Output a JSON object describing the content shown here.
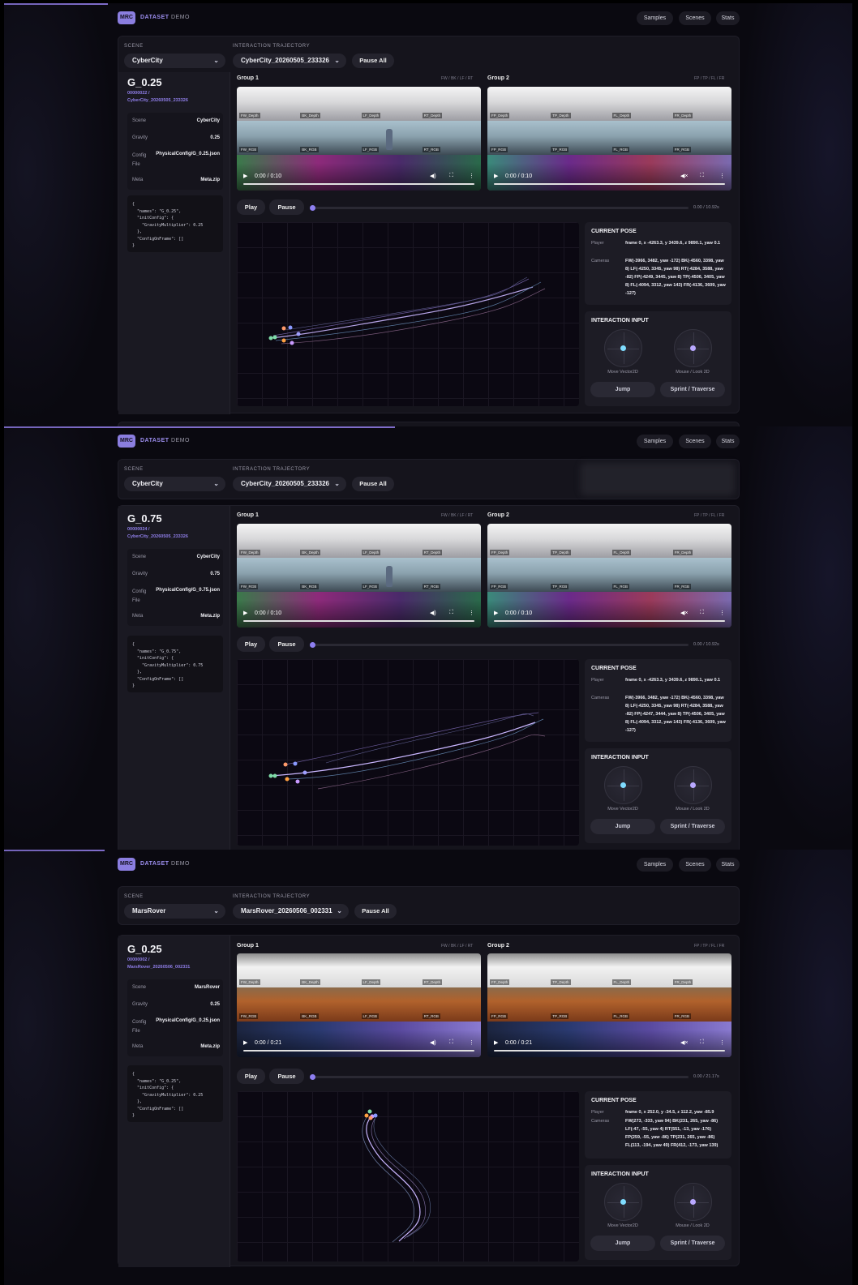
{
  "header": {
    "logo": "MRC",
    "brand_a": "DATASET",
    "brand_b": "DEMO",
    "nav": [
      "Samples",
      "Scenes",
      "Stats"
    ]
  },
  "labels": {
    "scene": "SCENE",
    "trajectory": "INTERACTION TRAJECTORY",
    "pause_all": "Pause All",
    "group1": "Group 1",
    "group2": "Group 2",
    "group1_views": "FW / BK / LF / RT",
    "group2_views": "FP / TP / FL / FR",
    "play": "Play",
    "pause": "Pause",
    "current_pose": "CURRENT POSE",
    "player": "Player",
    "cameras": "Cameras",
    "interaction_input": "INTERACTION INPUT",
    "move": "Move Vector2D",
    "look": "Mouse / Look 2D",
    "jump": "Jump",
    "sprint": "Sprint / Traverse",
    "k_scene": "Scene",
    "k_gravity": "Gravity",
    "k_config": "Config File",
    "k_meta": "Meta"
  },
  "tiles": {
    "g1_depth": [
      "FW_Depth",
      "BK_Depth",
      "LF_Depth",
      "RT_Depth"
    ],
    "g1_rgb": [
      "FW_RGB",
      "BK_RGB",
      "LF_RGB",
      "RT_RGB"
    ],
    "g2_depth": [
      "FP_Depth",
      "TP_Depth",
      "FL_Depth",
      "FR_Depth"
    ],
    "g2_rgb": [
      "FP_RGB",
      "TP_RGB",
      "FL_RGB",
      "FR_RGB"
    ]
  },
  "panels": [
    {
      "scene": "CyberCity",
      "trajectory": "CyberCity_20260505_233326",
      "title": "G_0.25",
      "sample_id": "00000022 /",
      "sample_name": "CyberCity_20260505_233326",
      "gravity": "0.25",
      "config": "PhysicalConfig/G_0.25.json",
      "meta": "Meta.zip",
      "json": "{\n  \"names\": \"G_0.25\",\n  \"initConfig\": {\n    \"GravityMultiplier\": 0.25\n  },\n  \"ConfigOnFrame\": []\n}",
      "video_time": "0:00 / 0:10",
      "slider_time": "0.00 / 10.92s",
      "player_pose": "frame 0, x -4263.3, y 3439.6, z 9890.1, yaw 0.1",
      "cameras_pose": "FW(-3966, 3482, yaw -172) BK(-4560, 3398, yaw 8) LF(-4250, 3345, yaw 98) RT(-4284, 3588, yaw -82) FP(-4249, 3445, yaw 8) TP(-4506, 3405, yaw 8) FL(-4094, 3312, yaw 143) FR(-4136, 3609, yaw -127)"
    },
    {
      "scene": "CyberCity",
      "trajectory": "CyberCity_20260505_233326",
      "title": "G_0.75",
      "sample_id": "00000024 /",
      "sample_name": "CyberCity_20260505_233326",
      "gravity": "0.75",
      "config": "PhysicalConfig/G_0.75.json",
      "meta": "Meta.zip",
      "json": "{\n  \"names\": \"G_0.75\",\n  \"initConfig\": {\n    \"GravityMultiplier\": 0.75\n  },\n  \"ConfigOnFrame\": []\n}",
      "video_time": "0:00 / 0:10",
      "slider_time": "0.00 / 10.92s",
      "player_pose": "frame 0, x -4263.3, y 3439.6, z 9890.1, yaw 0.1",
      "cameras_pose": "FW(-3966, 3482, yaw -172) BK(-4560, 3398, yaw 8) LF(-4250, 3345, yaw 98) RT(-4284, 3588, yaw -82) FP(-4247, 3444, yaw 8) TP(-4506, 3405, yaw 8) FL(-4094, 3312, yaw 143) FR(-4136, 3609, yaw -127)"
    },
    {
      "scene": "MarsRover",
      "trajectory": "MarsRover_20260506_002331",
      "title": "G_0.25",
      "sample_id": "00000002 /",
      "sample_name": "MarsRover_20260506_002331",
      "gravity": "0.25",
      "config": "PhysicalConfig/G_0.25.json",
      "meta": "Meta.zip",
      "json": "{\n  \"names\": \"G_0.25\",\n  \"initConfig\": {\n    \"GravityMultiplier\": 0.25\n  },\n  \"ConfigOnFrame\": []\n}",
      "video_time": "0:00 / 0:21",
      "slider_time": "0.00 / 21.17s",
      "player_pose": "frame 0, x 252.0, y -34.5, z 112.2, yaw -85.9",
      "cameras_pose": "FW(273, -333, yaw 94) BK(231, 265, yaw -86) LF(-47, -55, yaw 4) RT(551, -13, yaw -176) FP(259, -55, yaw -86) TP(231, 265, yaw -86) FL(113, -194, yaw 49) FR(412, -173, yaw 139)"
    }
  ],
  "colors": {
    "accent": "#8e7ff0",
    "move_dot": "#7fdcff",
    "look_dot": "#b9a8ff"
  },
  "icons": [
    "play-icon",
    "volume-icon",
    "fullscreen-icon",
    "more-icon",
    "chevron-down-icon"
  ]
}
